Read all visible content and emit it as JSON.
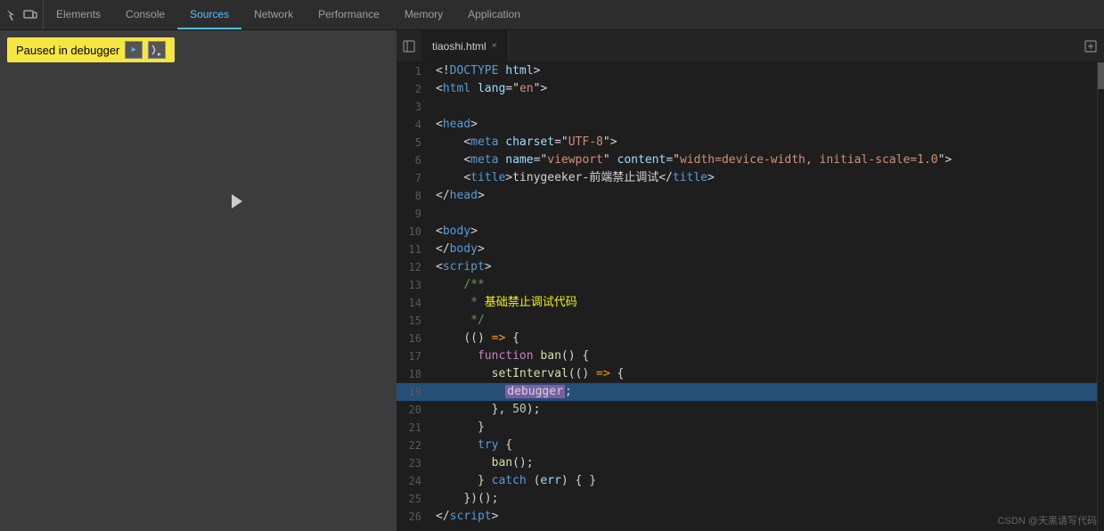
{
  "topbar": {
    "tabs": [
      {
        "label": "Elements",
        "active": false
      },
      {
        "label": "Console",
        "active": false
      },
      {
        "label": "Sources",
        "active": true
      },
      {
        "label": "Network",
        "active": false
      },
      {
        "label": "Performance",
        "active": false
      },
      {
        "label": "Memory",
        "active": false
      },
      {
        "label": "Application",
        "active": false
      }
    ]
  },
  "debugger": {
    "banner": "Paused in debugger",
    "resume_label": "▶",
    "step_label": "⏷"
  },
  "file_tab": {
    "name": "tiaoshi.html",
    "close": "×"
  },
  "watermark": "CSDN @天黑请写代码"
}
